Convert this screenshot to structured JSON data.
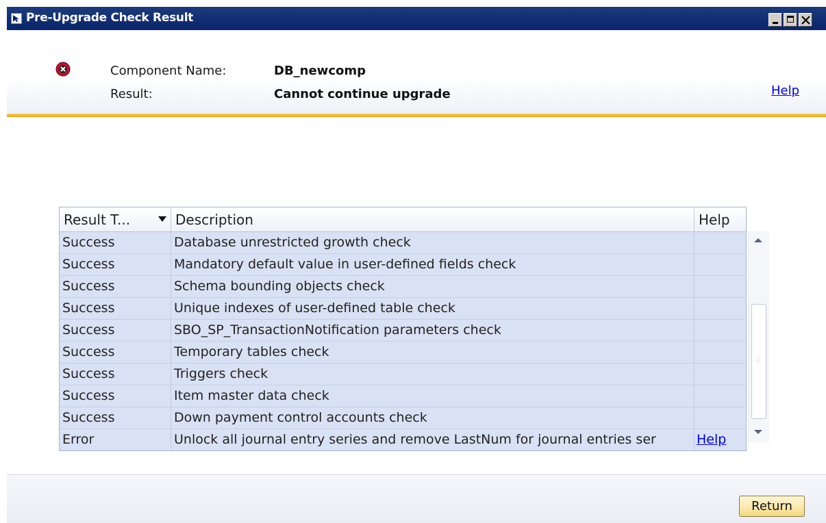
{
  "window": {
    "title": "Pre-Upgrade Check Result"
  },
  "header": {
    "component_label": "Component Name:",
    "component_value": "DB_newcomp",
    "result_label": "Result:",
    "result_value": "Cannot continue upgrade",
    "help_link": "Help"
  },
  "grid": {
    "columns": [
      "Result T...",
      "Description",
      "Help"
    ],
    "rows": [
      {
        "result": "Success",
        "description": "Database unrestricted growth check",
        "help": ""
      },
      {
        "result": "Success",
        "description": "Mandatory default value in user-defined fields check",
        "help": ""
      },
      {
        "result": "Success",
        "description": "Schema bounding objects check",
        "help": ""
      },
      {
        "result": "Success",
        "description": "Unique indexes of user-defined table check",
        "help": ""
      },
      {
        "result": "Success",
        "description": "SBO_SP_TransactionNotification parameters check",
        "help": ""
      },
      {
        "result": "Success",
        "description": "Temporary tables check",
        "help": ""
      },
      {
        "result": "Success",
        "description": "Triggers check",
        "help": ""
      },
      {
        "result": "Success",
        "description": "Item master data check",
        "help": ""
      },
      {
        "result": "Success",
        "description": "Down payment control accounts check",
        "help": ""
      },
      {
        "result": "Error",
        "description": "Unlock all journal entry series and remove LastNum for journal entries ser",
        "help": "Help"
      }
    ]
  },
  "footer": {
    "return_label": "Return"
  },
  "colors": {
    "titlebar": "#0a246a",
    "accent_line": "#f0b429",
    "grid_row_bg": "#d9e1f4",
    "link": "#0000ee"
  },
  "icons": {
    "app": "window-app-icon",
    "status": "error-icon"
  }
}
